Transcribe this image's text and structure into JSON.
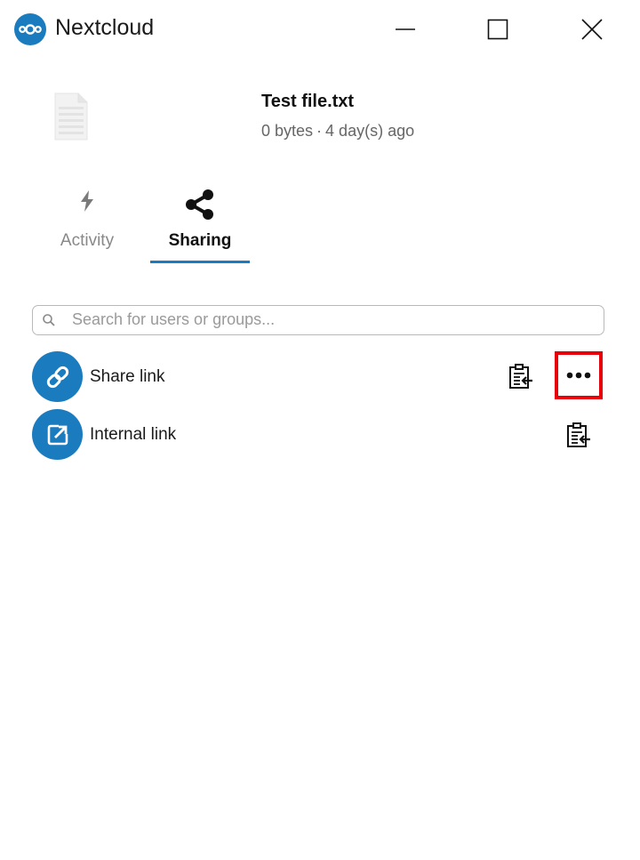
{
  "window": {
    "title": "Nextcloud",
    "minimize_icon": "minimize-icon",
    "maximize_icon": "maximize-icon",
    "close_icon": "close-icon",
    "brand_color": "#1a7bbf"
  },
  "file": {
    "name": "Test file.txt",
    "size": "0 bytes",
    "separator": "·",
    "modified": "4 day(s) ago"
  },
  "tabs": [
    {
      "label": "Activity",
      "icon": "lightning-icon",
      "active": false
    },
    {
      "label": "Sharing",
      "icon": "share-icon",
      "active": true
    }
  ],
  "search": {
    "placeholder": "Search for users or groups...",
    "value": ""
  },
  "shares": [
    {
      "label": "Share link",
      "icon": "link-icon",
      "actions": [
        "copy-link-icon",
        "more-options-icon"
      ]
    },
    {
      "label": "Internal link",
      "icon": "external-link-icon",
      "actions": [
        "copy-link-icon"
      ]
    }
  ],
  "highlight_color": "#e8000b"
}
